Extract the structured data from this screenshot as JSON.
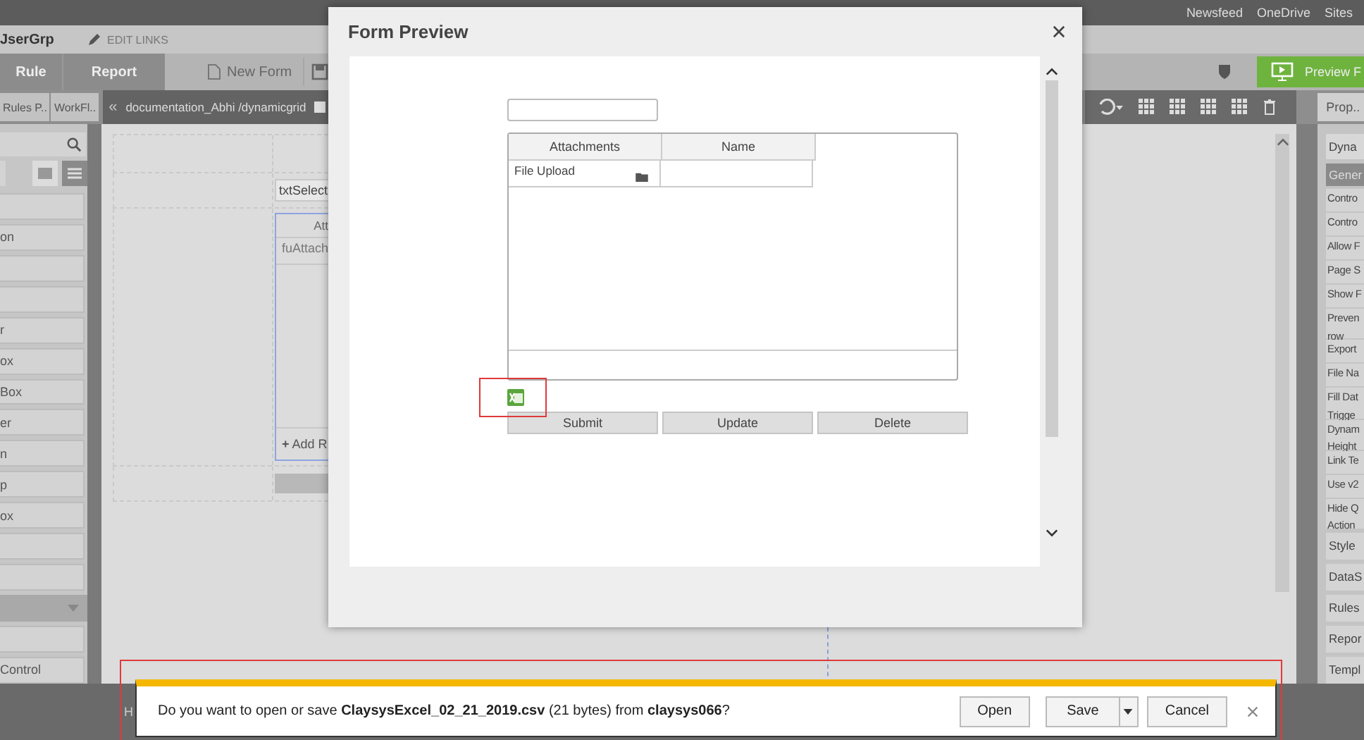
{
  "top_links": [
    "Newsfeed",
    "OneDrive",
    "Sites"
  ],
  "site_title": "JserGrp",
  "edit_links": "EDIT LINKS",
  "ribbon_tabs": [
    "Rule",
    "Report"
  ],
  "new_form": "New Form",
  "preview_button": "Preview F",
  "left_tabs": [
    "Rules P..",
    "WorkFl.."
  ],
  "collapse_glyph": "«",
  "breadcrumb": "documentation_Abhi /dynamicgrid",
  "breadcrumb_checkbox": {
    "checked": false
  },
  "properties_tab": "Prop..",
  "toolbox": [
    {
      "kind": "blank"
    },
    {
      "kind": "item",
      "label": "on"
    },
    {
      "kind": "blank"
    },
    {
      "kind": "blank"
    },
    {
      "kind": "item",
      "label": "r"
    },
    {
      "kind": "item",
      "label": "ox"
    },
    {
      "kind": "item",
      "label": "Box"
    },
    {
      "kind": "item",
      "label": "er"
    },
    {
      "kind": "item",
      "label": "n"
    },
    {
      "kind": "item",
      "label": "p"
    },
    {
      "kind": "item",
      "label": "ox"
    },
    {
      "kind": "blank"
    },
    {
      "kind": "blank"
    },
    {
      "kind": "section"
    },
    {
      "kind": "blank"
    },
    {
      "kind": "item",
      "label": "Control"
    }
  ],
  "canvas": {
    "select_field": "txtSelect",
    "grid_header": "Att",
    "grid_cell": "fuAttach",
    "add_row_glyph": "+",
    "add_row": "Add R"
  },
  "properties": {
    "control": "Dyna",
    "section": "Gener",
    "items": [
      "Contro",
      "Contro",
      "Allow F",
      "Page S",
      "Show F",
      "Preven\nrow",
      "Export",
      "File Na",
      "Fill Dat\nTrigge",
      "Dynam\nHeight",
      "Link Te",
      "Use v2",
      "Hide Q\nAction"
    ],
    "groups": [
      "Style",
      "DataS",
      "Rules",
      "Repor",
      "Templ"
    ]
  },
  "modal": {
    "title": "Form Preview",
    "columns": [
      "Attachments",
      "Name"
    ],
    "rows": [
      {
        "attachment": "File Upload"
      }
    ],
    "buttons": [
      "Submit",
      "Update",
      "Delete"
    ]
  },
  "download_bar": {
    "message": "Do you want to open or save **ClaysysExcel_02_21_2019.csv** (21 bytes) from **claysys066**?",
    "buttons": [
      "Open",
      "Save",
      "Cancel"
    ]
  },
  "status_strip": "H"
}
